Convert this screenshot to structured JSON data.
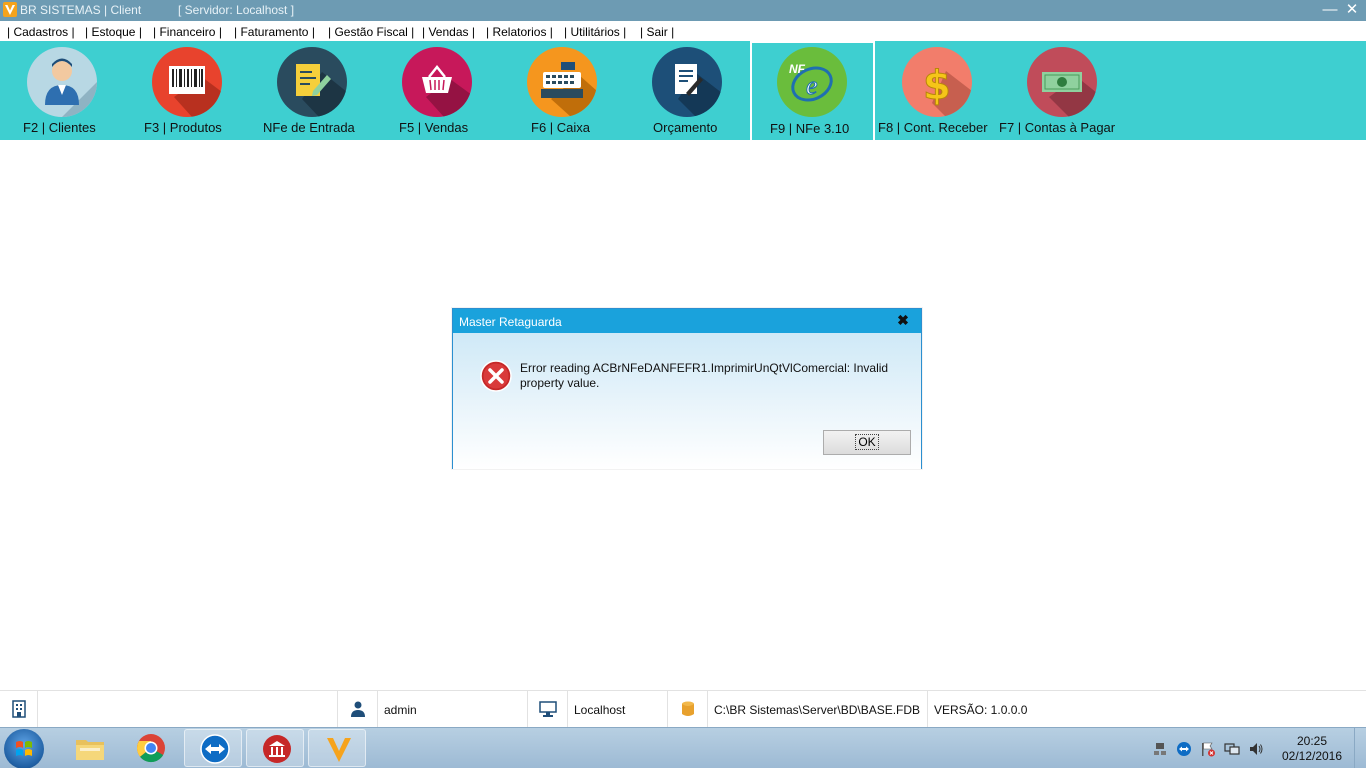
{
  "window": {
    "app_title": "BR SISTEMAS | Client",
    "server_label": "[ Servidor: Localhost ]",
    "minimize_glyph": "—",
    "close_glyph": "✕"
  },
  "menu": {
    "items": [
      "| Cadastros |",
      "| Estoque |",
      "| Financeiro |",
      "| Faturamento |",
      "| Gestão Fiscal |",
      "| Vendas |",
      "| Relatorios |",
      "| Utilitários |",
      "| Sair |"
    ]
  },
  "toolbar": {
    "buttons": [
      {
        "label": "F2 | Clientes",
        "icon": "customer-icon",
        "color": "#b8d8e4"
      },
      {
        "label": "F3 | Produtos",
        "icon": "barcode-icon",
        "color": "#e8432d"
      },
      {
        "label": "NFe de Entrada",
        "icon": "document-edit-icon",
        "color": "#2a4b5e"
      },
      {
        "label": "F5 | Vendas",
        "icon": "basket-icon",
        "color": "#c7185a"
      },
      {
        "label": "F6 | Caixa",
        "icon": "cash-register-icon",
        "color": "#f5961e"
      },
      {
        "label": "Orçamento",
        "icon": "quote-document-icon",
        "color": "#1d4f78"
      },
      {
        "label": "F9 | NFe 3.10",
        "icon": "nfe-logo-icon",
        "color": "#6abd3c"
      },
      {
        "label": "F8 | Cont. Receber",
        "icon": "dollar-icon",
        "color": "#f27d6b"
      },
      {
        "label": "F7 | Contas à Pagar",
        "icon": "banknote-icon",
        "color": "#c04c5a"
      }
    ]
  },
  "dialog": {
    "title": "Master Retaguarda",
    "close_glyph": "✖",
    "message": "Error reading ACBrNFeDANFEFR1.ImprimirUnQtVlComercial: Invalid property value.",
    "ok_label": "OK"
  },
  "statusbar": {
    "user": "admin",
    "host": "Localhost",
    "db_path": "C:\\BR Sistemas\\Server\\BD\\BASE.FDB",
    "version": "VERSÃO: 1.0.0.0"
  },
  "taskbar": {
    "time": "20:25",
    "date": "02/12/2016"
  }
}
